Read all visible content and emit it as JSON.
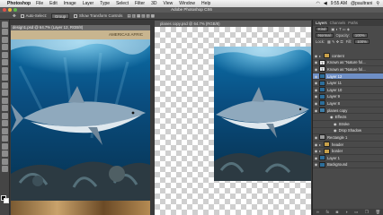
{
  "menubar": {
    "app_name": "Photoshop",
    "items": [
      "File",
      "Edit",
      "Image",
      "Layer",
      "Type",
      "Select",
      "Filter",
      "3D",
      "View",
      "Window",
      "Help"
    ],
    "time": "9:55 AM",
    "user": "@paultrani"
  },
  "window_title": "Adobe Photoshop CS6",
  "options": {
    "auto_select_label": "Auto-Select:",
    "auto_select_value": "Group",
    "show_transform_label": "Show Transform Controls"
  },
  "documents": [
    {
      "tab": "design1.psd @ 64.7% (Layer 12, RGB/8)",
      "header_text": "AMERICAS   AFRIC"
    },
    {
      "tab": "planes copy.psd @ 64.7% (RGB/8)"
    }
  ],
  "layers_panel": {
    "tabs": [
      "Layers",
      "Channels",
      "Paths"
    ],
    "filter": "Kind",
    "blend_mode": "Normal",
    "opacity_label": "Opacity:",
    "opacity_value": "100%",
    "lock_label": "Lock:",
    "fill_label": "Fill:",
    "fill_value": "100%",
    "rows": [
      {
        "label": "content",
        "kind": "group",
        "selected": false
      },
      {
        "label": "Known as \"Nature fol...",
        "kind": "text",
        "selected": false
      },
      {
        "label": "Known as \"Nature fol...",
        "kind": "text",
        "selected": false
      },
      {
        "label": "Layer 12",
        "kind": "image",
        "selected": true
      },
      {
        "label": "Layer 11",
        "kind": "image",
        "selected": false
      },
      {
        "label": "Layer 10",
        "kind": "image",
        "selected": false
      },
      {
        "label": "Layer 9",
        "kind": "image",
        "selected": false
      },
      {
        "label": "Layer 8",
        "kind": "image",
        "selected": false
      },
      {
        "label": "planes copy",
        "kind": "smart",
        "selected": false
      },
      {
        "label": "Effects",
        "kind": "fx",
        "selected": false
      },
      {
        "label": "Stroke",
        "kind": "fx-item",
        "selected": false
      },
      {
        "label": "Drop Shadow",
        "kind": "fx-item",
        "selected": false
      },
      {
        "label": "Rectangle 1",
        "kind": "shape",
        "selected": false
      },
      {
        "label": "header",
        "kind": "group",
        "selected": false
      },
      {
        "label": "border",
        "kind": "group",
        "selected": false
      },
      {
        "label": "Layer 1",
        "kind": "image",
        "selected": false
      },
      {
        "label": "Background",
        "kind": "image",
        "selected": false
      }
    ]
  },
  "colors": {
    "menubar": "#e4e4e4",
    "workspace": "#3a3a3a",
    "selected_layer": "#6e8fc6",
    "ocean_top": "#0b6fa8",
    "ocean_deep": "#06314f"
  }
}
